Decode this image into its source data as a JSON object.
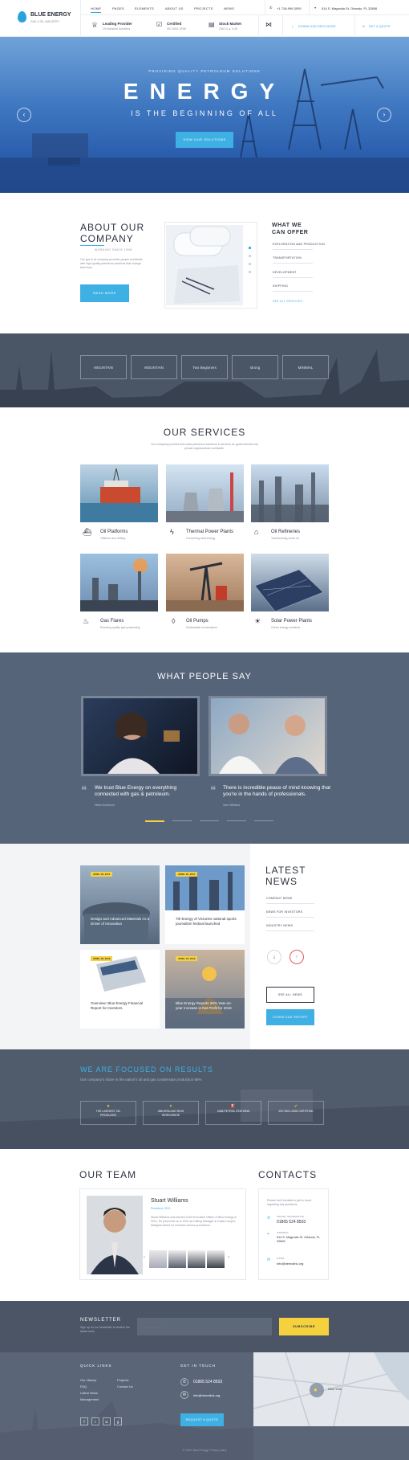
{
  "brand": {
    "name": "BLUE ENERGY",
    "tagline": "GAS & OIL INDUSTRY"
  },
  "nav": [
    "HOME",
    "PAGES",
    "ELEMENTS",
    "ABOUT US",
    "PROJECTS",
    "NEWS"
  ],
  "header": {
    "phone": "+1 718-999-3939",
    "address": "514 S. Magnolia St. Orlando, FL 32806",
    "info": [
      {
        "title": "Leading Provider",
        "sub": "Of Industrial Solutions"
      },
      {
        "title": "Certified",
        "sub": "ISO 9001-2008"
      },
      {
        "title": "Stock Market",
        "sub": "236.13 ▲ 4.45"
      }
    ],
    "download_brochure": "DOWNLOAD BROCHURE",
    "get_quote": "GET A QUOTE"
  },
  "hero": {
    "subtitle": "PROVIDING QUALITY PETROLEUM SOLUTIONS",
    "title": "ENERGY",
    "tagline": "IS THE BEGINNING OF ALL",
    "button": "VIEW OUR SOLUTIONS",
    "prev": "‹",
    "next": "›"
  },
  "about": {
    "title_1": "ABOUT OUR",
    "title_2": "COMPANY",
    "since": "WORKING SINCE 1996",
    "text": "Our gas & oil company provides people worldwide with high-quality petroleum solutions that change their lives.",
    "button": "READ MORE",
    "offer_title_1": "WHAT WE",
    "offer_title_2": "CAN OFFER",
    "offers": [
      "EXPLORATION AND PRODUCTION",
      "TRANSPORTATION",
      "DEVELOPMENT",
      "SHIPPING"
    ],
    "see_all": "SEE ALL SERVICES"
  },
  "partners": [
    "MOUNTAIN",
    "MOUNTAIN",
    "Two Beginners",
    "strong",
    "MINIMAL"
  ],
  "services": {
    "title": "OUR SERVICES",
    "intro": "Our company provides first-class petroleum solutions & services for governmental and private organizations worldwide.",
    "items": [
      {
        "title": "Oil Platforms",
        "sub": "Offshore and drilling"
      },
      {
        "title": "Thermal Power Plants",
        "sub": "Converting heat energy"
      },
      {
        "title": "Oil Refineries",
        "sub": "Transforming crude oil"
      },
      {
        "title": "Gas Flares",
        "sub": "Ensuring quality gas processing"
      },
      {
        "title": "Oil Pumps",
        "sub": "Sustainable oil extraction"
      },
      {
        "title": "Solar Power Plants",
        "sub": "Green energy solutions"
      }
    ]
  },
  "testimonials": {
    "title": "WHAT PEOPLE SAY",
    "items": [
      {
        "quote": "We trust Blue Energy on everything connected with gas & petroleum.",
        "name": "Helen Anderson"
      },
      {
        "quote": "There is incredible peace of mind knowing that you're in the hands of professionals.",
        "name": "Sam Williams"
      }
    ]
  },
  "news": {
    "title_1": "LATEST",
    "title_2": "NEWS",
    "cards": [
      {
        "date": "APRIL 05, 2017",
        "text": "Design and Advanced Materials As a Driver of Innovation"
      },
      {
        "date": "APRIL 05, 2017",
        "text": "7th Energy of Victories national sports journalism festival launched"
      },
      {
        "date": "APRIL 05, 2016",
        "text": "Overview: Blue Energy Financial Report for Investors"
      },
      {
        "date": "APRIL 05, 2016",
        "text": "Blue Energy Reports 26% Year-on-year Increase in Net Profit for 2016"
      }
    ],
    "categories": [
      "COMPANY NEWS",
      "NEWS FOR INVESTORS",
      "INDUSTRY NEWS"
    ],
    "see_all": "SEE ALL NEWS",
    "download": "DOWNLOAD REPORT"
  },
  "results": {
    "title": "WE ARE FOCUSED ON RESULTS",
    "sub": "Our company's share in the nation's oil and gas condensate production 68%",
    "items": [
      "THE LARGEST OIL PRODUCER",
      "468 DRILLING RIGS WORLDWIDE",
      "2468 PETROL STATIONS",
      "ISO 9001-2008 CERTIFIED"
    ]
  },
  "team": {
    "title": "OUR TEAM",
    "name": "Stuart Williams",
    "role": "President, CEO",
    "bio": "Stuart Williams was elected Chief Executive Officer of Blue Energy in 2010. He joined the us in 2001 as Drilling Manager in Kuala Lumpur, Malaysia where he received various promotions."
  },
  "contacts": {
    "title": "CONTACTS",
    "intro": "Please don't hesitate to get in touch regarding any questions.",
    "phone_label": "PHONE / INFORMATION",
    "phone": "01865 524 8503",
    "address_label": "ADDRESS",
    "address": "514 S. Magnolia St. Orlando, FL 32806",
    "email_label": "E-MAIL",
    "email": "info@demolink.org"
  },
  "newsletter": {
    "title": "NEWSLETTER",
    "text": "Sign up for our newsletter to receive the latest news.",
    "placeholder": "Your E-mail*",
    "button": "SUBSCRIBE"
  },
  "footer": {
    "quick_links": "QUICK LINKS",
    "links": [
      "Our History",
      "Projects",
      "FAQ",
      "Contact Us",
      "Latest News",
      "Management"
    ],
    "get_in_touch": "GET IN TOUCH",
    "phone": "01865 524 8503",
    "email": "info@demolink.org",
    "quote_button": "REQUEST A QUOTE",
    "map_label": "New York",
    "copyright": "© 2018. Blue Energy. Privacy policy"
  },
  "colors": {
    "accent": "#3fb0e4",
    "dark": "#4b5566",
    "yellow": "#f5d13e"
  }
}
